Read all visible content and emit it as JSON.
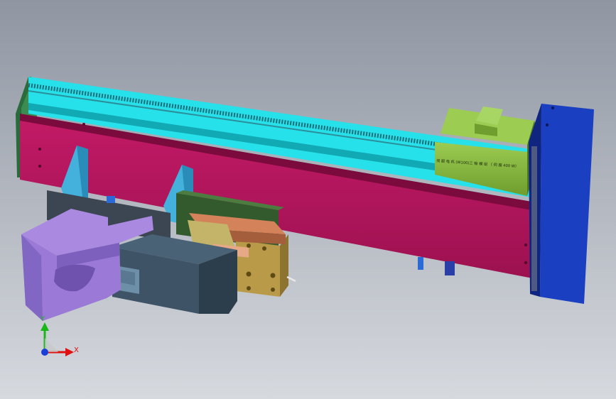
{
  "viewport": {
    "background_top": "#8f96a2",
    "background_bottom": "#d6d9de"
  },
  "model": {
    "motor_label": "伺 服 电 机 (W100)三 轴 模 组 （ 伺 服 400 W）",
    "colors": {
      "beam": "#b0145a",
      "beam_dark": "#7c0b3d",
      "rail": "#26e0ea",
      "rail_dark": "#10a9b4",
      "motor": "#82b33c",
      "motor_dark": "#4f7a1f",
      "end_block": "#1a3fc0",
      "end_block_dark": "#0f2580",
      "purple_part": "#9a7ad6",
      "slate_part": "#3e5366",
      "brass_part": "#b89a48",
      "copper_part": "#d4825a",
      "green_plate": "#335a2c"
    }
  },
  "triad": {
    "x_label": "X",
    "y_label": "Y",
    "x_color": "#e01010",
    "y_color": "#18b818",
    "z_color": "#1a3ed8"
  }
}
